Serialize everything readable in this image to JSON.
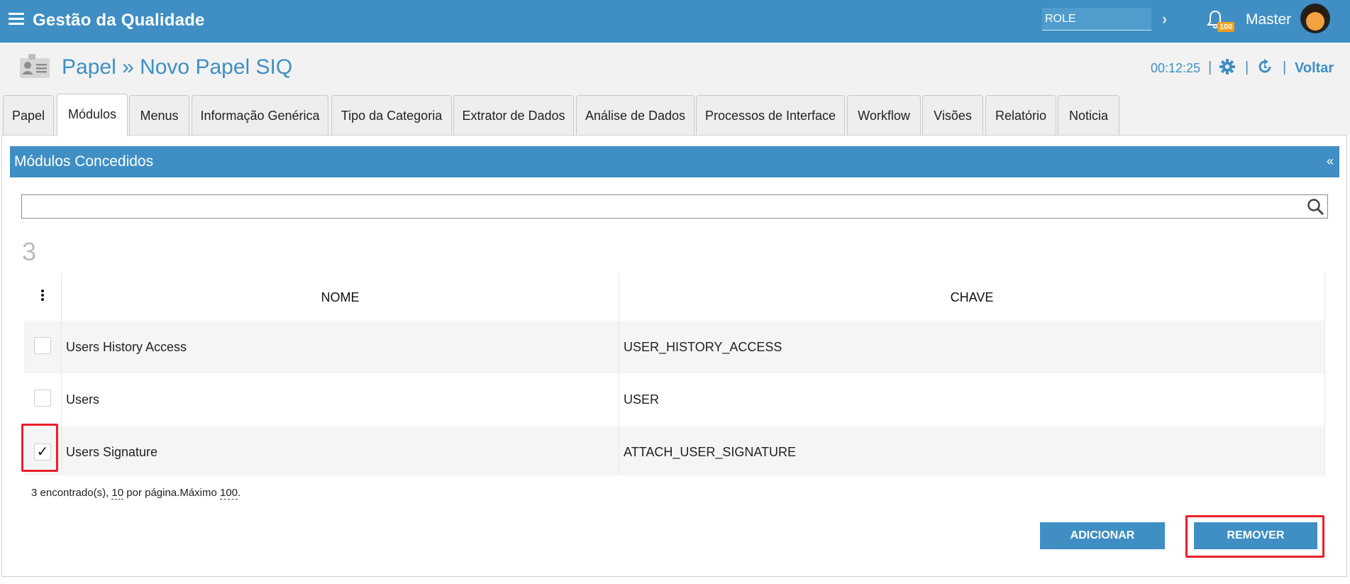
{
  "header": {
    "app_title": "Gestão da Qualidade",
    "role_value": "ROLE",
    "notification_count": "100",
    "user_name": "Master"
  },
  "subheader": {
    "page_title": "Papel » Novo Papel SIQ",
    "timer": "00:12:25",
    "back_label": "Voltar",
    "separator": "|"
  },
  "tabs": [
    {
      "label": "Papel"
    },
    {
      "label": "Módulos"
    },
    {
      "label": "Menus"
    },
    {
      "label": "Informação Genérica"
    },
    {
      "label": "Tipo da Categoria"
    },
    {
      "label": "Extrator de Dados"
    },
    {
      "label": "Análise de Dados"
    },
    {
      "label": "Processos de Interface"
    },
    {
      "label": "Workflow"
    },
    {
      "label": "Visões"
    },
    {
      "label": "Relatório"
    },
    {
      "label": "Noticia"
    }
  ],
  "active_tab": "Módulos",
  "panel": {
    "title": "Módulos Concedidos",
    "collapse": "«",
    "search_value": "",
    "count": "3"
  },
  "table": {
    "columns": [
      "NOME",
      "CHAVE"
    ],
    "rows": [
      {
        "nome": "Users History Access",
        "chave": "USER_HISTORY_ACCESS",
        "checked": false
      },
      {
        "nome": "Users",
        "chave": "USER",
        "checked": false
      },
      {
        "nome": "Users Signature",
        "chave": "ATTACH_USER_SIGNATURE",
        "checked": true
      }
    ],
    "check_mark": "✓"
  },
  "footer": {
    "found": "3 encontrado(s), ",
    "per_page": "10",
    "per_page_text": " por página.Máximo ",
    "max": "100",
    "end": "."
  },
  "buttons": {
    "add": "ADICIONAR",
    "remove": "REMOVER"
  },
  "colors": {
    "primary": "#3f8fc4",
    "highlight": "#e8202a",
    "badge": "#f0a020"
  }
}
